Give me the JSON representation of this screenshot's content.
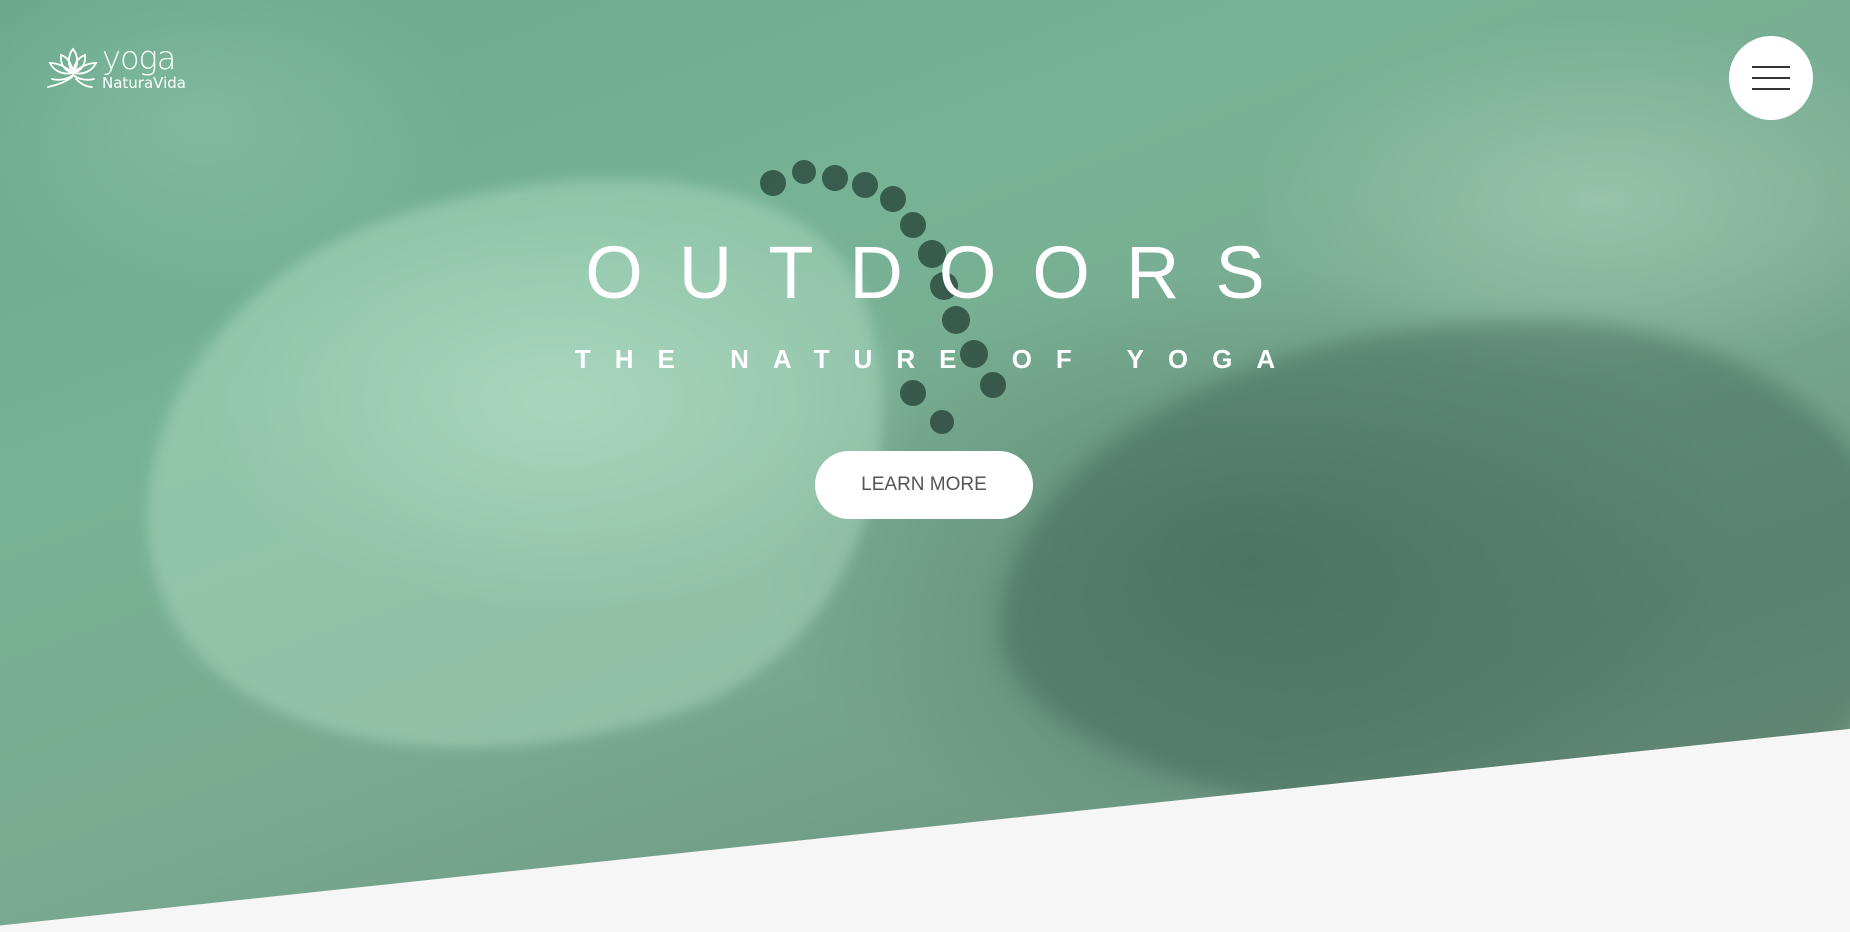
{
  "brand": {
    "line1": "yoga",
    "line2": "NaturaVida",
    "logo_icon": "lotus-icon"
  },
  "menu": {
    "icon": "hamburger-menu-icon"
  },
  "hero": {
    "title": "OUTDOORS",
    "subtitle": "THE NATURE OF YOGA",
    "button_label": "LEARN MORE",
    "overlay_color": "#6fae92",
    "below_fold_color": "#f6f6f6"
  }
}
